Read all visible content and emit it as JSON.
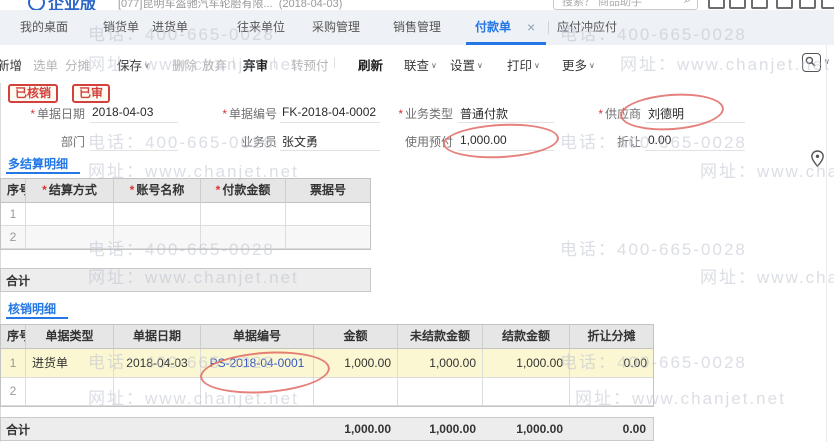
{
  "header": {
    "logo_text": "企业版",
    "account_text": "[077]昆明车盔驰汽车轮胎有限...",
    "account_date": "(2018-04-03)",
    "search_placeholder": "搜索？ 商品助手",
    "search_icon": "⌕"
  },
  "tabs": {
    "items": [
      "我的桌面",
      "销货单",
      "进货单",
      "往来单位",
      "采购管理",
      "销售管理",
      "付款单",
      "应付冲应付"
    ],
    "close_glyph": "×"
  },
  "toolbar": {
    "items": [
      "新增",
      "选单",
      "分摊",
      "保存",
      "删除",
      "放弃",
      "弃审",
      "转预付",
      "刷新",
      "联查",
      "设置",
      "打印",
      "更多"
    ],
    "caret": "∨",
    "separator": "|"
  },
  "stamps": [
    "已核销",
    "已审"
  ],
  "form": {
    "required_mark": "*",
    "bill_date": {
      "label": "单据日期",
      "value": "2018-04-03"
    },
    "bill_no": {
      "label": "单据编号",
      "value": "FK-2018-04-0002"
    },
    "biz_type": {
      "label": "业务类型",
      "value": "普通付款"
    },
    "supplier": {
      "label": "供应商",
      "value": "刘德明"
    },
    "department": {
      "label": "部门",
      "value": ""
    },
    "salesman": {
      "label": "业务员",
      "value": "张文勇"
    },
    "prepay": {
      "label": "使用预付",
      "value": "1,000.00"
    },
    "discount": {
      "label": "折让",
      "value": "0.00"
    }
  },
  "settlement": {
    "tab_label": "多结算明细",
    "headers": [
      "序号",
      "结算方式",
      "账号名称",
      "付款金额",
      "票据号"
    ],
    "rows": [
      [
        "1",
        "",
        "",
        "",
        ""
      ],
      [
        "2",
        "",
        "",
        "",
        ""
      ]
    ],
    "total_label": "合计"
  },
  "verification": {
    "tab_label": "核销明细",
    "headers": [
      "序号",
      "单据类型",
      "单据日期",
      "单据编号",
      "金额",
      "未结款金额",
      "结款金额",
      "折让分摊"
    ],
    "rows": [
      [
        "1",
        "进货单",
        "2018-04-03",
        "PS-2018-04-0001",
        "1,000.00",
        "1,000.00",
        "1,000.00",
        "0.00"
      ],
      [
        "2",
        "",
        "",
        "",
        "",
        "",
        "",
        ""
      ]
    ],
    "total_label": "合计",
    "totals": [
      "1,000.00",
      "1,000.00",
      "1,000.00",
      "0.00"
    ]
  },
  "watermark": {
    "phone": "电话：400-665-0028",
    "site": "网址：www.chanjet.net"
  },
  "colors": {
    "accent_blue": "#2478e5",
    "stamp_red": "#d3413c",
    "row_highlight": "#fbf7d2",
    "link_blue": "#3558c0",
    "tabbar_bg": "#eef1f5"
  }
}
